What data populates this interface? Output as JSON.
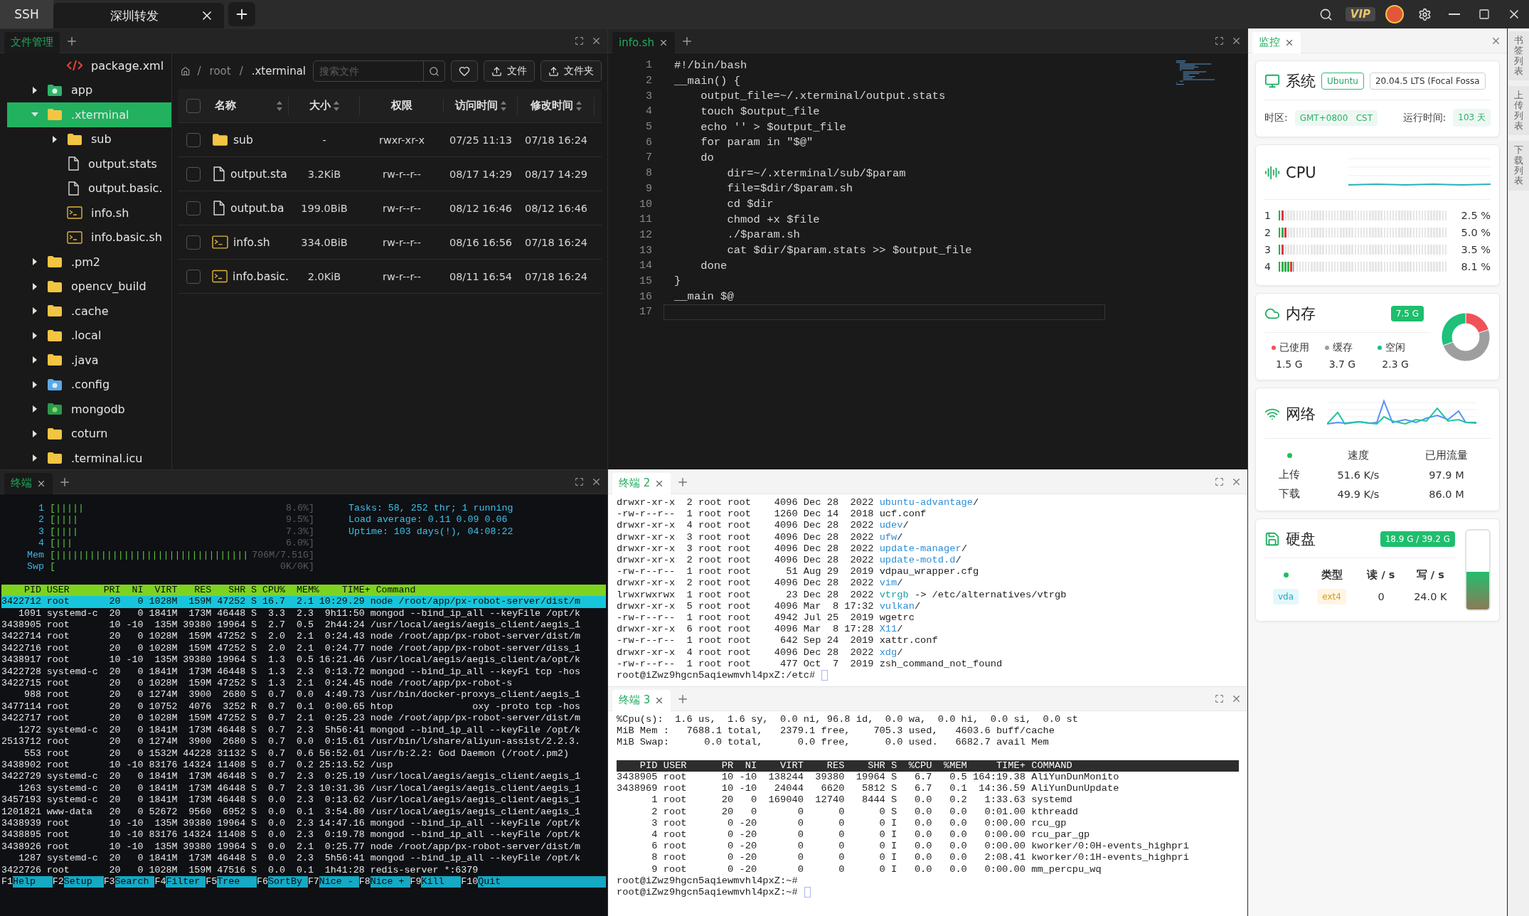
{
  "top_bar": {
    "mode": "SSH",
    "tabs": [
      {
        "label": "深圳转发",
        "selected": true
      }
    ],
    "vip": "VIP"
  },
  "file_manager": {
    "tab": {
      "label": "文件管理",
      "selected": true
    },
    "tree": [
      {
        "children": [
          {
            "name": "package.xml",
            "kind": "code",
            "selected": false
          }
        ]
      },
      {
        "name": "app",
        "kind": "app",
        "expanded": false,
        "selected": false
      },
      {
        "name": ".xterminal",
        "kind": "folder",
        "expanded": true,
        "selected": true,
        "children": [
          {
            "name": "sub",
            "kind": "folder",
            "expanded": false,
            "selected": false
          },
          {
            "name": "output.stats",
            "kind": "file",
            "selected": false
          },
          {
            "name": "output.basic.",
            "kind": "file",
            "selected": false
          },
          {
            "name": "info.sh",
            "kind": "script",
            "selected": false
          },
          {
            "name": "info.basic.sh",
            "kind": "script",
            "selected": false
          }
        ]
      },
      {
        "name": ".pm2",
        "kind": "folder",
        "expanded": false,
        "selected": false
      },
      {
        "name": "opencv_build",
        "kind": "folder",
        "expanded": false,
        "selected": false
      },
      {
        "name": ".cache",
        "kind": "folder",
        "expanded": false,
        "selected": false
      },
      {
        "name": ".local",
        "kind": "folder",
        "expanded": false,
        "selected": false
      },
      {
        "name": ".java",
        "kind": "folder",
        "expanded": false,
        "selected": false
      },
      {
        "name": ".config",
        "kind": "config",
        "expanded": false,
        "selected": false
      },
      {
        "name": "mongodb",
        "kind": "mongodb",
        "expanded": false,
        "selected": false
      },
      {
        "name": "coturn",
        "kind": "folder",
        "expanded": false,
        "selected": false
      },
      {
        "name": ".terminal.icu",
        "kind": "folder",
        "expanded": false,
        "selected": false
      }
    ],
    "breadcrumb": [
      {
        "kind": "separator",
        "text": "/"
      },
      {
        "kind": "link",
        "text": "root"
      },
      {
        "kind": "separator",
        "text": "/"
      },
      {
        "kind": "current",
        "text": ".xterminal"
      }
    ],
    "search": {
      "placeholder": "搜索文件"
    },
    "buttons": [
      {
        "kind": "favorite"
      },
      {
        "kind": "upload",
        "label": "文件"
      },
      {
        "kind": "upload",
        "label": "文件夹"
      }
    ],
    "select_all": {
      "checked": false
    },
    "columns": [
      {
        "label": "名称",
        "sortable": true
      },
      {
        "label": "大小",
        "sortable": true
      },
      {
        "label": "权限",
        "sortable": false
      },
      {
        "label": "访问时间",
        "sortable": true
      },
      {
        "label": "修改时间",
        "sortable": true
      }
    ],
    "rows": [
      {
        "checked": false,
        "kind": "folder",
        "name": "sub",
        "size": "-",
        "permissions": "rwxr-xr-x",
        "accessed": "07/25 11:13",
        "modified": "07/18 16:24"
      },
      {
        "checked": false,
        "kind": "file",
        "name": "output.sta",
        "size": "3.2KiB",
        "permissions": "rw-r--r--",
        "accessed": "08/17 14:29",
        "modified": "08/17 14:29"
      },
      {
        "checked": false,
        "kind": "file",
        "name": "output.ba",
        "size": "199.0BiB",
        "permissions": "rw-r--r--",
        "accessed": "08/12 16:46",
        "modified": "08/12 16:46"
      },
      {
        "checked": false,
        "kind": "script",
        "name": "info.sh",
        "size": "334.0BiB",
        "permissions": "rw-r--r--",
        "accessed": "08/16 16:56",
        "modified": "07/18 16:24"
      },
      {
        "checked": false,
        "kind": "script",
        "name": "info.basic.",
        "size": "2.0KiB",
        "permissions": "rw-r--r--",
        "accessed": "08/11 16:54",
        "modified": "07/18 16:24"
      }
    ]
  },
  "editor": {
    "tab": {
      "label": "info.sh",
      "selected": true
    },
    "lines": [
      {
        "number": "1",
        "code": "#!/bin/bash",
        "current": false
      },
      {
        "number": "2",
        "code": "__main() {",
        "current": false
      },
      {
        "number": "3",
        "code": "    output_file=~/.xterminal/output.stats",
        "current": false
      },
      {
        "number": "4",
        "code": "    touch $output_file",
        "current": false
      },
      {
        "number": "5",
        "code": "    echo '' > $output_file",
        "current": false
      },
      {
        "number": "6",
        "code": "    for param in \"$@\"",
        "current": false
      },
      {
        "number": "7",
        "code": "    do",
        "current": false
      },
      {
        "number": "8",
        "code": "        dir=~/.xterminal/sub/$param",
        "current": false
      },
      {
        "number": "9",
        "code": "        file=$dir/$param.sh",
        "current": false
      },
      {
        "number": "10",
        "code": "        cd $dir",
        "current": false
      },
      {
        "number": "11",
        "code": "        chmod +x $file",
        "current": false
      },
      {
        "number": "12",
        "code": "        ./$param.sh",
        "current": false
      },
      {
        "number": "13",
        "code": "        cat $dir/$param.stats >> $output_file",
        "current": false
      },
      {
        "number": "14",
        "code": "    done",
        "current": false
      },
      {
        "number": "15",
        "code": "}",
        "current": false
      },
      {
        "number": "16",
        "code": "__main $@",
        "current": false
      },
      {
        "number": "17",
        "current": true
      }
    ]
  },
  "terminal_1": {
    "tab": {
      "label": "终端",
      "selected": true
    },
    "meters": [
      {
        "label": "1",
        "bar": "[|||||",
        "reading": "8.6%]"
      },
      {
        "label": "2",
        "bar": "[||||",
        "reading": "9.5%]"
      },
      {
        "label": "3",
        "bar": "[||||",
        "reading": "7.3%]"
      },
      {
        "label": "4",
        "bar": "[|||",
        "reading": "6.0%]"
      },
      {
        "label": "Mem",
        "bar": "[||||||||||||||||||||||||||||||||||",
        "reading": "706M/7.51G]"
      },
      {
        "label": "Swp",
        "bar": "[",
        "reading": "0K/0K]"
      }
    ],
    "summary": [
      "Tasks: 58, 252 thr; 1 running",
      "Load average: 0.11 0.09 0.06",
      "Uptime: 103 days(!), 04:08:22"
    ],
    "header": "    PID USER      PRI  NI  VIRT   RES   SHR S CPU%  MEM%    TIME+ Command",
    "rows": [
      {
        "text": "3422712 root       20   0 1028M  159M 47252 S 16.7  2.1 10:29.29 node /root/app/px-robot-server/dist/m",
        "selected": true
      },
      {
        "text": "   1091 systemd-c  20   0 1841M  173M 46448 S  3.3  2.3  9h11:50 mongod --bind_ip_all --keyFile /opt/k",
        "selected": false
      },
      {
        "text": "3438905 root       10 -10  135M 39380 19964 S  2.7  0.5  2h44:24 /usr/local/aegis/aegis_client/aegis_1",
        "selected": false
      },
      {
        "text": "3422714 root       20   0 1028M  159M 47252 S  2.0  2.1  0:24.43 node /root/app/px-robot-server/dist/m",
        "selected": false
      },
      {
        "text": "3422716 root       20   0 1028M  159M 47252 S  2.0  2.1  0:24.77 node /root/app/px-robot-server/diss_1",
        "selected": false
      },
      {
        "text": "3438917 root       10 -10  135M 39380 19964 S  1.3  0.5 16:21.46 /usr/local/aegis/aegis_client/a/opt/k",
        "selected": false
      },
      {
        "text": "3422728 systemd-c  20   0 1841M  173M 46448 S  1.3  2.3  0:13.72 mongod --bind_ip_all --keyFi tcp -hos",
        "selected": false
      },
      {
        "text": "3422715 root       20   0 1028M  159M 47252 S  1.3  2.1  0:24.45 node /root/app/px-robot-s",
        "selected": false
      },
      {
        "text": "    988 root       20   0 1274M  3900  2680 S  0.7  0.0  4:49.73 /usr/bin/docker-proxys_client/aegis_1",
        "selected": false
      },
      {
        "text": "3477114 root       20   0 10752  4076  3252 R  0.7  0.1  0:00.65 htop              oxy -proto tcp -hos",
        "selected": false
      },
      {
        "text": "3422717 root       20   0 1028M  159M 47252 S  0.7  2.1  0:25.23 node /root/app/px-robot-server/dist/m",
        "selected": false
      },
      {
        "text": "   1272 systemd-c  20   0 1841M  173M 46448 S  0.7  2.3  5h56:41 mongod --bind_ip_all --keyFile /opt/k",
        "selected": false
      },
      {
        "text": "2513712 root       20   0 1274M  3900  2680 S  0.7  0.0  0:15.61 /usr/bin/l/share/aliyun-assist/2.2.3.",
        "selected": false
      },
      {
        "text": "    553 root       20   0 1532M 44228 31132 S  0.7  0.6 56:52.01 /usr/b:2.2: God Daemon (/root/.pm2)",
        "selected": false
      },
      {
        "text": "3438902 root       10 -10 83176 14324 11408 S  0.7  0.2 25:13.52 /usp",
        "selected": false
      },
      {
        "text": "3422729 systemd-c  20   0 1841M  173M 46448 S  0.7  2.3  0:25.19 /usr/local/aegis/aegis_client/aegis_1",
        "selected": false
      },
      {
        "text": "   1263 systemd-c  20   0 1841M  173M 46448 S  0.7  2.3 10:31.36 /usr/local/aegis/aegis_client/aegis_1",
        "selected": false
      },
      {
        "text": "3457193 systemd-c  20   0 1841M  173M 46448 S  0.0  2.3  0:13.62 /usr/local/aegis/aegis_client/aegis_1",
        "selected": false
      },
      {
        "text": "1201821 www-data   20   0 52672  9560  6952 S  0.0  0.1  3:54.80 /usr/local/aegis/aegis_client/aegis_1",
        "selected": false
      },
      {
        "text": "3438939 root       10 -10  135M 39380 19964 S  0.0  2.3 14:47.16 mongod --bind_ip_all --keyFile /opt/k",
        "selected": false
      },
      {
        "text": "3438895 root       10 -10 83176 14324 11408 S  0.0  2.3  0:19.78 mongod --bind_ip_all --keyFile /opt/k",
        "selected": false
      },
      {
        "text": "3438926 root       10 -10  135M 39380 19964 S  0.0  2.1  0:25.77 node /root/app/px-robot-server/dist/m",
        "selected": false
      },
      {
        "text": "   1287 systemd-c  20   0 1841M  173M 46448 S  0.0  2.3  5h56:41 mongod --bind_ip_all --keyFile /opt/k",
        "selected": false
      },
      {
        "text": "3422726 root       20   0 1028M  159M 47516 S  0.0  0.1  1h41:28 redis-server *:6379",
        "selected": false
      }
    ],
    "function_keys": [
      {
        "key": "F1",
        "label": "Help"
      },
      {
        "key": "F2",
        "label": "Setup"
      },
      {
        "key": "F3",
        "label": "Search"
      },
      {
        "key": "F4",
        "label": "Filter"
      },
      {
        "key": "F5",
        "label": "Tree"
      },
      {
        "key": "F6",
        "label": "SortBy"
      },
      {
        "key": "F7",
        "label": "Nice -"
      },
      {
        "key": "F8",
        "label": "Nice +"
      },
      {
        "key": "F9",
        "label": "Kill"
      },
      {
        "key": "F10",
        "label": "Quit"
      }
    ]
  },
  "terminal_2": {
    "tab": {
      "label": "终端 2",
      "selected": true
    },
    "lines": [
      {
        "meta": "drwxr-xr-x  2 root root    4096 Dec 28  2022 ",
        "name": "ubuntu-advantage",
        "kind": "dir",
        "suffix": "/"
      },
      {
        "meta": "-rw-r--r--  1 root root    1260 Dec 14  2018 ",
        "name": "ucf.conf",
        "kind": "file"
      },
      {
        "meta": "drwxr-xr-x  4 root root    4096 Dec 28  2022 ",
        "name": "udev",
        "kind": "dir",
        "suffix": "/"
      },
      {
        "meta": "drwxr-xr-x  3 root root    4096 Dec 28  2022 ",
        "name": "ufw",
        "kind": "dir",
        "suffix": "/"
      },
      {
        "meta": "drwxr-xr-x  3 root root    4096 Dec 28  2022 ",
        "name": "update-manager",
        "kind": "dir",
        "suffix": "/"
      },
      {
        "meta": "drwxr-xr-x  2 root root    4096 Dec 28  2022 ",
        "name": "update-motd.d",
        "kind": "dir",
        "suffix": "/"
      },
      {
        "meta": "-rw-r--r--  1 root root      51 Aug 29  2019 ",
        "name": "vdpau_wrapper.cfg",
        "kind": "file"
      },
      {
        "meta": "drwxr-xr-x  2 root root    4096 Dec 28  2022 ",
        "name": "vim",
        "kind": "dir",
        "suffix": "/"
      },
      {
        "meta": "lrwxrwxrwx  1 root root      23 Dec 28  2022 ",
        "name": "vtrgb",
        "kind": "link",
        "suffix": " -> /etc/alternatives/vtrgb"
      },
      {
        "meta": "drwxr-xr-x  5 root root    4096 Mar  8 17:32 ",
        "name": "vulkan",
        "kind": "dir",
        "suffix": "/"
      },
      {
        "meta": "-rw-r--r--  1 root root    4942 Jul 25  2019 ",
        "name": "wgetrc",
        "kind": "file"
      },
      {
        "meta": "drwxr-xr-x  6 root root    4096 Mar  8 17:28 ",
        "name": "X11",
        "kind": "dir",
        "suffix": "/"
      },
      {
        "meta": "-rw-r--r--  1 root root     642 Sep 24  2019 ",
        "name": "xattr.conf",
        "kind": "file"
      },
      {
        "meta": "drwxr-xr-x  4 root root    4096 Dec 28  2022 ",
        "name": "xdg",
        "kind": "dir",
        "suffix": "/"
      },
      {
        "meta": "-rw-r--r--  1 root root     477 Oct  7  2019 ",
        "name": "zsh_command_not_found",
        "kind": "file"
      }
    ],
    "prompts": [
      {
        "text": "root@iZwz9hgcn5aqiewmvhl4pxZ:/etc#",
        "cursor": true
      }
    ]
  },
  "terminal_3": {
    "tab": {
      "label": "终端 3",
      "selected": true
    },
    "summary": [
      "%Cpu(s):  1.6 us,  1.6 sy,  0.0 ni, 96.8 id,  0.0 wa,  0.0 hi,  0.0 si,  0.0 st",
      "MiB Mem :   7688.1 total,   2379.1 free,    705.3 used,   4603.6 buff/cache",
      "MiB Swap:      0.0 total,      0.0 free,      0.0 used.   6682.7 avail Mem"
    ],
    "header": "    PID USER      PR  NI    VIRT    RES    SHR S  %CPU  %MEM     TIME+ COMMAND",
    "rows": [
      "3438905 root      10 -10  138244  39380  19964 S   6.7   0.5 164:19.38 AliYunDunMonito",
      "3438969 root      10 -10   24044   6620   5812 S   6.7   0.1  14:36.59 AliYunDunUpdate",
      "      1 root      20   0  169040  12740   8444 S   0.0   0.2   1:33.63 systemd",
      "      2 root      20   0       0      0      0 S   0.0   0.0   0:01.00 kthreadd",
      "      3 root       0 -20       0      0      0 I   0.0   0.0   0:00.00 rcu_gp",
      "      4 root       0 -20       0      0      0 I   0.0   0.0   0:00.00 rcu_par_gp",
      "      6 root       0 -20       0      0      0 I   0.0   0.0   0:00.00 kworker/0:0H-events_highpri",
      "      8 root       0 -20       0      0      0 I   0.0   0.0   2:08.41 kworker/0:1H-events_highpri",
      "      9 root       0 -20       0      0      0 I   0.0   0.0   0:00.00 mm_percpu_wq"
    ],
    "prompts": [
      {
        "text": "root@iZwz9hgcn5aqiewmvhl4pxZ:~#",
        "cursor": false
      },
      {
        "text": "root@iZwz9hgcn5aqiewmvhl4pxZ:~#",
        "cursor": true
      }
    ]
  },
  "monitor": {
    "tab": {
      "label": "监控",
      "selected": true
    },
    "system": {
      "title": "系统",
      "os": "Ubuntu",
      "version": "20.04.5 LTS (Focal Fossa",
      "timezone_label": "时区:",
      "timezone": "GMT+0800   CST",
      "uptime_label": "运行时间:",
      "uptime": "103 天"
    },
    "cpu": {
      "title": "CPU",
      "cores": [
        {
          "label": "1",
          "level": 0.025,
          "reading": "2.5 %"
        },
        {
          "label": "2",
          "level": 0.05,
          "reading": "5.0 %"
        },
        {
          "label": "3",
          "level": 0.035,
          "reading": "3.5 %"
        },
        {
          "label": "4",
          "level": 0.081,
          "reading": "8.1 %"
        }
      ]
    },
    "memory": {
      "title": "内存",
      "total": "7.5 G",
      "legend": [
        {
          "value": "1.5 G",
          "color": "#f0525a"
        },
        {
          "value": "3.7 G",
          "color": "#9e9e9e"
        },
        {
          "value": "2.3 G",
          "color": "#1ec07a"
        }
      ],
      "chart_data": {
        "type": "donut",
        "categories": [
          "已使用",
          "缓存",
          "空闲"
        ],
        "values": [
          20,
          49.3,
          30.7
        ]
      }
    },
    "network": {
      "title": "网络",
      "columns": [
        "速度",
        "已用流量"
      ],
      "rows": [
        {
          "label": "上传",
          "speed": "51.6 K/s",
          "used": "97.9 M"
        },
        {
          "label": "下载",
          "speed": "49.9 K/s",
          "used": "86.0 M"
        }
      ]
    },
    "disk": {
      "title": "硬盘",
      "usage": "18.9 G / 39.2 G",
      "level": 0.48,
      "columns": [
        "类型",
        "读 / s",
        "写 / s"
      ],
      "rows": [
        {
          "device": "vda",
          "type": "ext4",
          "read": "0",
          "write": "24.0 K"
        }
      ]
    }
  },
  "side_tabs": [
    {
      "label": "书签列表"
    },
    {
      "label": "上传列表"
    },
    {
      "label": "下载列表"
    }
  ]
}
